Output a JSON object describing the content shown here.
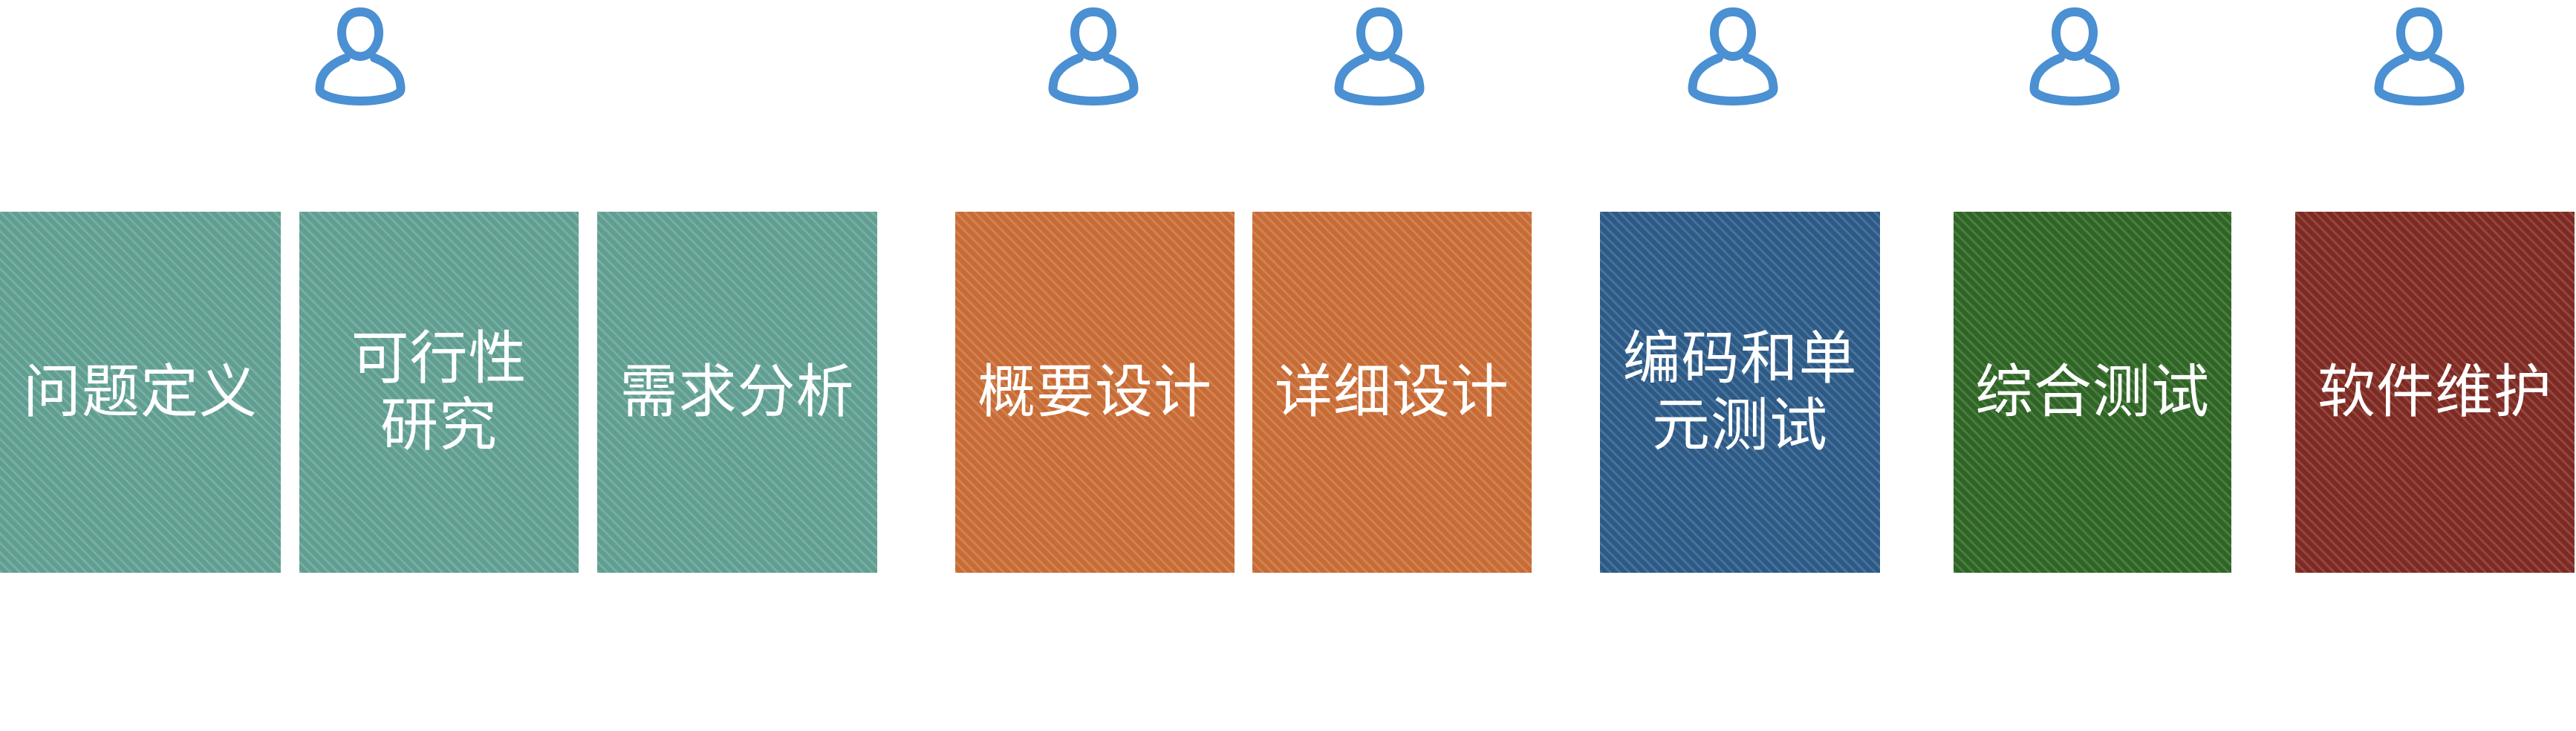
{
  "people": [
    {
      "icon": "person-icon"
    },
    {
      "icon": "person-icon"
    },
    {
      "icon": "person-icon"
    },
    {
      "icon": "person-icon"
    },
    {
      "icon": "person-icon"
    },
    {
      "icon": "person-icon"
    }
  ],
  "icon_color": "#4a90d2",
  "stages": [
    {
      "label": "问题定义",
      "color": "#5f9e91"
    },
    {
      "label": "可行性研究",
      "color": "#5f9e91"
    },
    {
      "label": "需求分析",
      "color": "#5f9e91"
    },
    {
      "label": "概要设计",
      "color": "#c86b34"
    },
    {
      "label": "详细设计",
      "color": "#c86b34"
    },
    {
      "label": "编码和单元测试",
      "color": "#2c5a87"
    },
    {
      "label": "综合测试",
      "color": "#2f6524"
    },
    {
      "label": "软件维护",
      "color": "#7e2a22"
    }
  ]
}
